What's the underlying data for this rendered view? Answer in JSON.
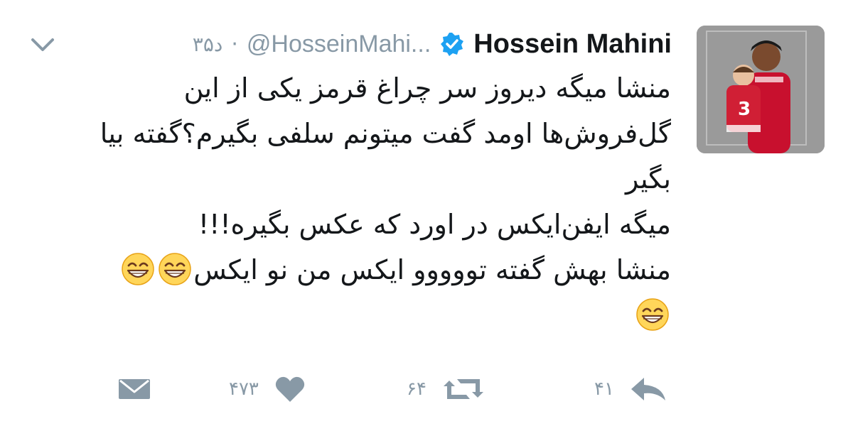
{
  "tweet": {
    "display_name": "Hossein Mahini",
    "handle": "@HosseinMahi...",
    "separator": "·",
    "time": "۳۵د",
    "text_lines": [
      "منشا میگه دیروز سر چراغ قرمز یکی از این",
      "گل‌فروش‌ها اومد گفت میتونم سلفی بگیرم؟گفته بیا",
      "بگیر",
      "میگه ایفن‌ایکس در اورد که عکس بگیره!!!",
      "منشا بهش گفته تووووو ایکس من نو ایکس"
    ],
    "emoji_name": "grinning-face-with-smiling-eyes",
    "emoji_count_line5": 2,
    "emoji_count_line6": 1
  },
  "actions": {
    "reply_count": "۴۱",
    "retweet_count": "۶۴",
    "like_count": "۴۷۳"
  },
  "icons": {
    "verified": "verified-badge-icon",
    "caret": "chevron-down-icon",
    "reply": "reply-icon",
    "retweet": "retweet-icon",
    "like": "heart-icon",
    "dm": "direct-message-icon"
  },
  "colors": {
    "text": "#14171a",
    "muted": "#8899a6",
    "verified": "#1da1f2",
    "emoji_face": "#ffd65a"
  }
}
